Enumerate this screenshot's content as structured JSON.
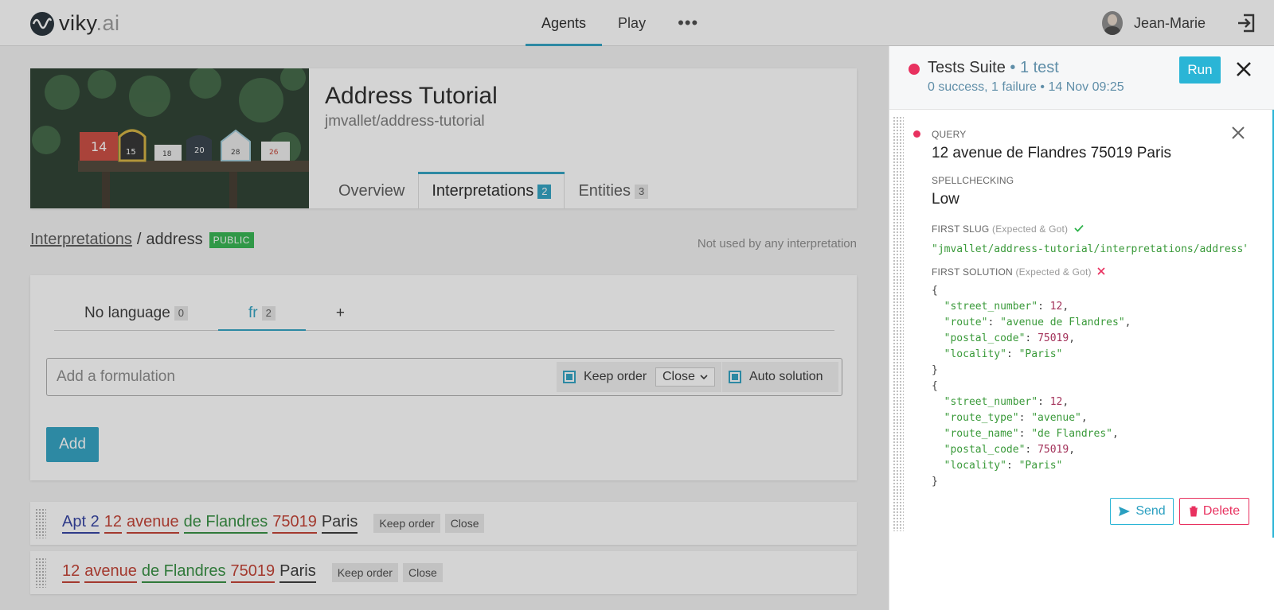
{
  "header": {
    "logo_main": "viky",
    "logo_ai": ".ai",
    "nav": [
      {
        "label": "Agents"
      },
      {
        "label": "Play"
      },
      {
        "label": "•••"
      }
    ],
    "user_name": "Jean-Marie"
  },
  "agent": {
    "title": "Address Tutorial",
    "slug": "jmvallet/address-tutorial",
    "tabs": [
      {
        "label": "Overview",
        "count": ""
      },
      {
        "label": "Interpretations",
        "count": "2"
      },
      {
        "label": "Entities",
        "count": "3"
      }
    ],
    "mailbox_numbers": [
      "14",
      "15",
      "18",
      "20",
      "28",
      "26"
    ]
  },
  "breadcrumb": {
    "link": "Interpretations",
    "separator": "/",
    "current": "address",
    "badge": "PUBLIC",
    "usage_note": "Not used by any interpretation"
  },
  "formulation_form": {
    "languages": [
      {
        "label": "No language",
        "count": "0"
      },
      {
        "label": "fr",
        "count": "2"
      },
      {
        "label": "+",
        "count": ""
      }
    ],
    "placeholder": "Add a formulation",
    "keep_order_label": "Keep order",
    "proximity_value": "Close",
    "auto_solution_label": "Auto solution",
    "add_button": "Add"
  },
  "formulations": [
    {
      "tokens": [
        "Apt 2",
        "12",
        "avenue",
        "de Flandres",
        "75019",
        "Paris"
      ],
      "tags": [
        "Keep order",
        "Close"
      ]
    },
    {
      "tokens": [
        "12",
        "avenue",
        "de Flandres",
        "75019",
        "Paris"
      ],
      "tags": [
        "Keep order",
        "Close"
      ]
    }
  ],
  "tests_panel": {
    "title": "Tests Suite",
    "title_count": "• 1 test",
    "summary": "0 success, 1 failure • 14 Nov 09:25",
    "run_button": "Run",
    "test": {
      "query_label": "QUERY",
      "query": "12 avenue de Flandres 75019 Paris",
      "spellcheck_label": "SPELLCHECKING",
      "spellcheck": "Low",
      "slug_label": "FIRST SLUG",
      "slug_hint": "(Expected & Got)",
      "slug_value": "\"jmvallet/address-tutorial/interpretations/address\"",
      "solution_label": "FIRST SOLUTION",
      "solution_hint": "(Expected & Got)",
      "expected": [
        {
          "key": "street_number",
          "value": "12",
          "kind": "num"
        },
        {
          "key": "route",
          "value": "\"avenue de Flandres\"",
          "kind": "str"
        },
        {
          "key": "postal_code",
          "value": "75019",
          "kind": "num"
        },
        {
          "key": "locality",
          "value": "\"Paris\"",
          "kind": "str"
        }
      ],
      "got": [
        {
          "key": "street_number",
          "value": "12",
          "kind": "num"
        },
        {
          "key": "route_type",
          "value": "\"avenue\"",
          "kind": "str"
        },
        {
          "key": "route_name",
          "value": "\"de Flandres\"",
          "kind": "str"
        },
        {
          "key": "postal_code",
          "value": "75019",
          "kind": "num"
        },
        {
          "key": "locality",
          "value": "\"Paris\"",
          "kind": "str"
        }
      ],
      "send_button": "Send",
      "delete_button": "Delete"
    }
  },
  "colors": {
    "accent": "#2a9fc0",
    "failure": "#e8315f",
    "success": "#2eb34b"
  }
}
